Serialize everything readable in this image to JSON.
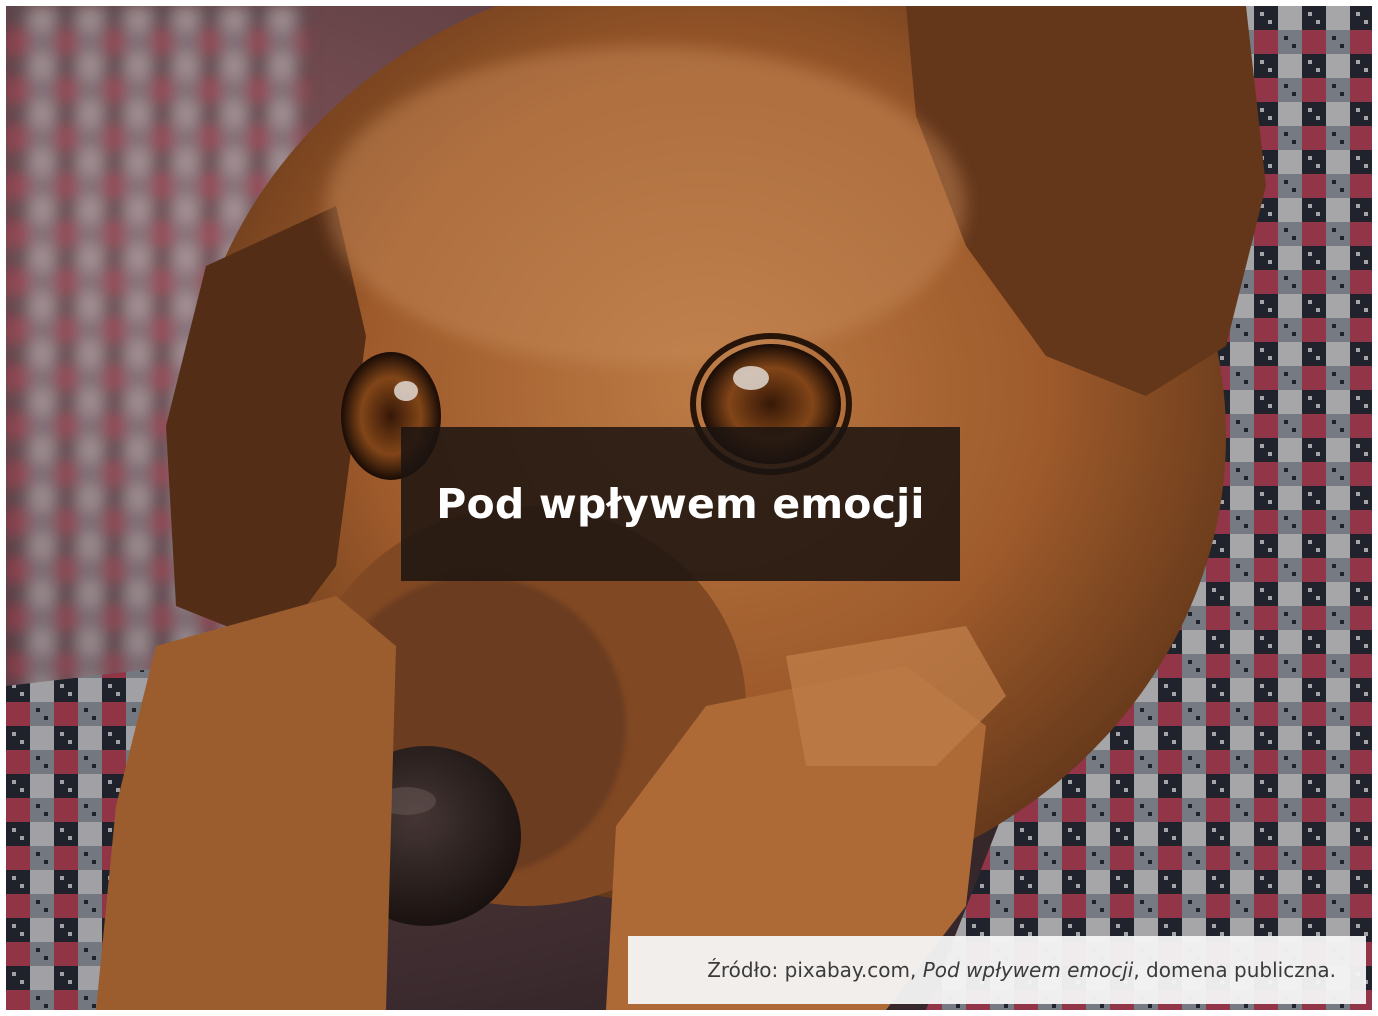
{
  "title": "Pod wpływem emocji",
  "caption": {
    "prefix": "Źródło: pixabay.com, ",
    "work_title": "Pod wpływem emocji",
    "suffix": ", domena publiczna."
  },
  "photo": {
    "subject": "dog-photo"
  },
  "colors": {
    "overlay": "#1c1410",
    "caption_bg": "#f4f4f4",
    "fur": "#b06a33",
    "blanket_red": "#c0465e",
    "blanket_dark": "#2b2f3a"
  }
}
